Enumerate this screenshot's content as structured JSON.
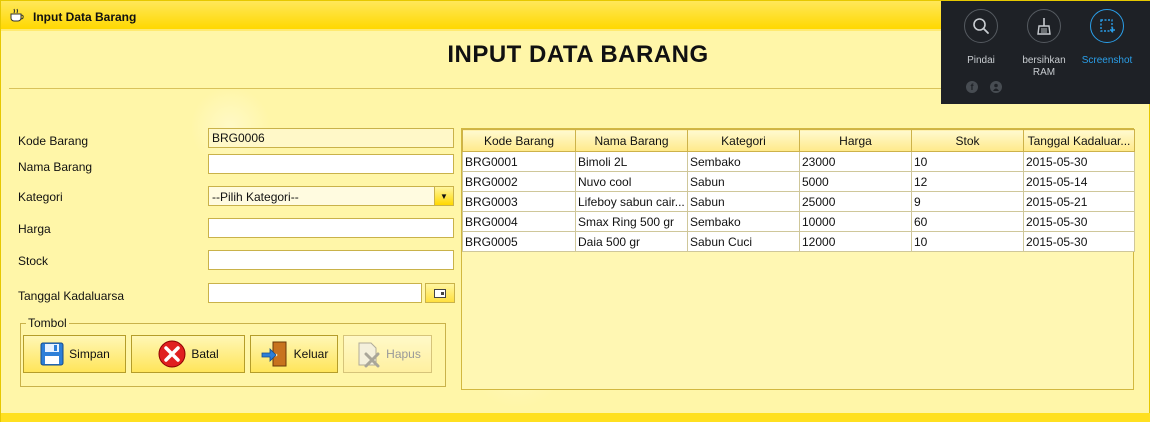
{
  "window": {
    "title": "Input Data Barang"
  },
  "header": {
    "title": "INPUT DATA BARANG"
  },
  "form": {
    "kode_label": "Kode Barang",
    "kode_value": "BRG0006",
    "nama_label": "Nama Barang",
    "nama_value": "",
    "kategori_label": "Kategori",
    "kategori_selected": "--Pilih Kategori--",
    "harga_label": "Harga",
    "harga_value": "",
    "stock_label": "Stock",
    "stock_value": "",
    "tanggal_label": "Tanggal Kadaluarsa",
    "tanggal_value": ""
  },
  "buttons": {
    "group_label": "Tombol",
    "simpan": "Simpan",
    "batal": "Batal",
    "keluar": "Keluar",
    "hapus": "Hapus"
  },
  "table": {
    "columns": [
      "Kode Barang",
      "Nama Barang",
      "Kategori",
      "Harga",
      "Stok",
      "Tanggal Kadaluar..."
    ],
    "rows": [
      [
        "BRG0001",
        "Bimoli 2L",
        "Sembako",
        "23000",
        "10",
        "2015-05-30"
      ],
      [
        "BRG0002",
        "Nuvo cool",
        "Sabun",
        "5000",
        "12",
        "2015-05-14"
      ],
      [
        "BRG0003",
        "Lifeboy sabun cair...",
        "Sabun",
        "25000",
        "9",
        "2015-05-21"
      ],
      [
        "BRG0004",
        "Smax Ring 500 gr",
        "Sembako",
        "10000",
        "60",
        "2015-05-30"
      ],
      [
        "BRG0005",
        "Daia 500 gr",
        "Sabun Cuci",
        "12000",
        "10",
        "2015-05-30"
      ]
    ]
  },
  "overlay": {
    "pindai": "Pindai",
    "bersihkan_line1": "bersihkan",
    "bersihkan_line2": "RAM",
    "screenshot": "Screenshot",
    "facebook_icon": "f",
    "accent_color": "#2a9ee8"
  }
}
